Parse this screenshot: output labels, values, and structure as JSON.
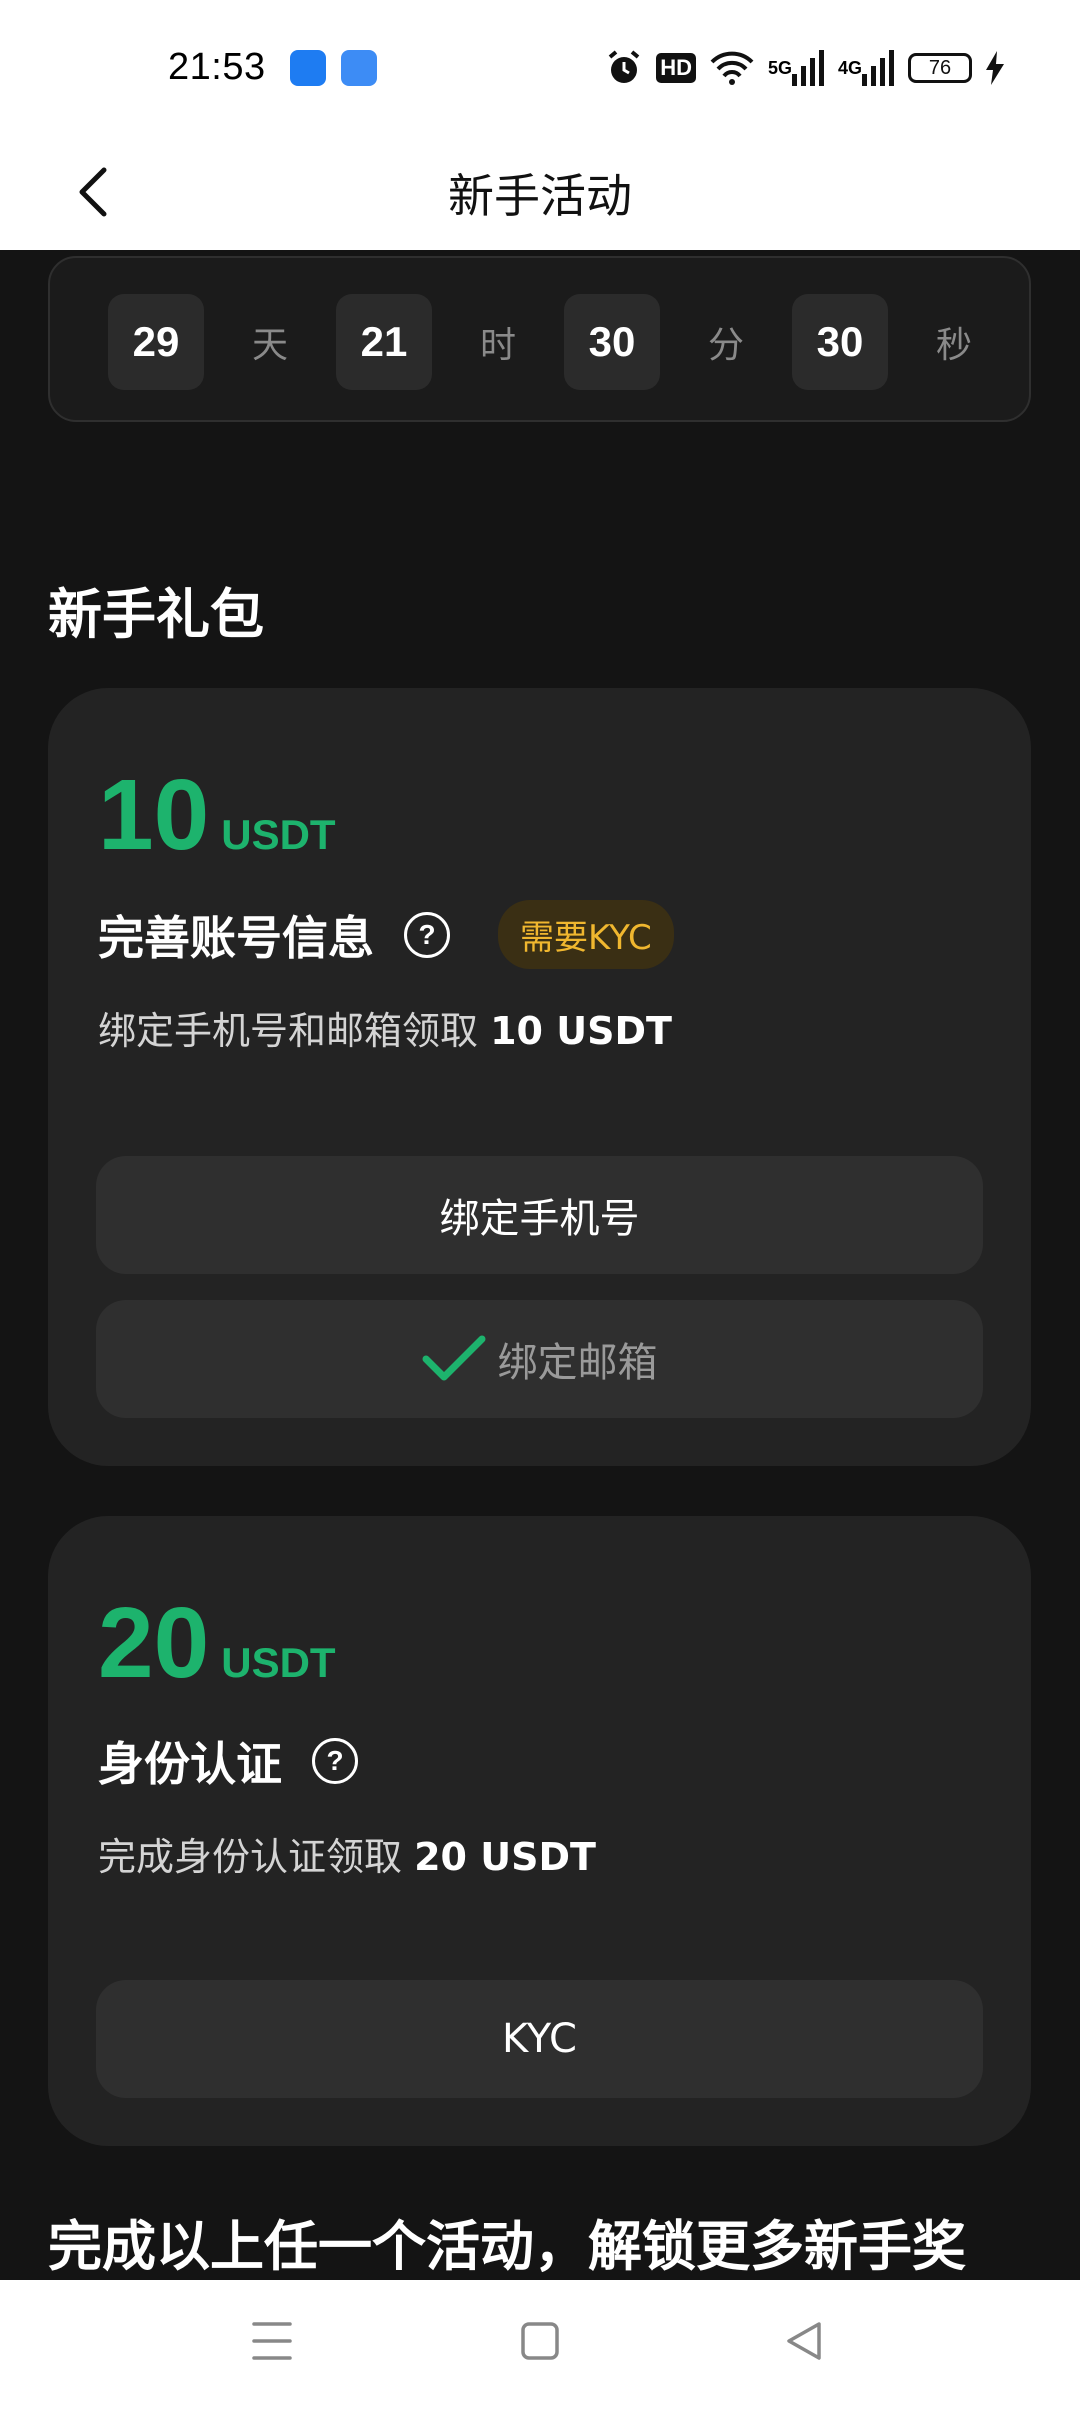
{
  "status": {
    "time": "21:53",
    "hd": "HD",
    "net1": "5G",
    "net2": "4G",
    "battery": "76"
  },
  "header": {
    "title": "新手活动"
  },
  "countdown": {
    "days": "29",
    "days_unit": "天",
    "hours": "21",
    "hours_unit": "时",
    "minutes": "30",
    "minutes_unit": "分",
    "seconds": "30",
    "seconds_unit": "秒"
  },
  "section_title": "新手礼包",
  "card1": {
    "amount": "10",
    "unit": "USDT",
    "title": "完善账号信息",
    "badge": "需要KYC",
    "desc_prefix": "绑定手机号和邮箱领取",
    "desc_reward": "10 USDT",
    "btn_phone": "绑定手机号",
    "btn_email": "绑定邮箱"
  },
  "card2": {
    "amount": "20",
    "unit": "USDT",
    "title": "身份认证",
    "desc_prefix": "完成身份认证领取",
    "desc_reward": "20 USDT",
    "btn_kyc": "KYC"
  },
  "bottom_title": "完成以上任一个活动，解锁更多新手奖",
  "colors": {
    "accent_green": "#1db36d",
    "badge_gold": "#f0b72f",
    "background": "#141414",
    "card": "#232323"
  }
}
